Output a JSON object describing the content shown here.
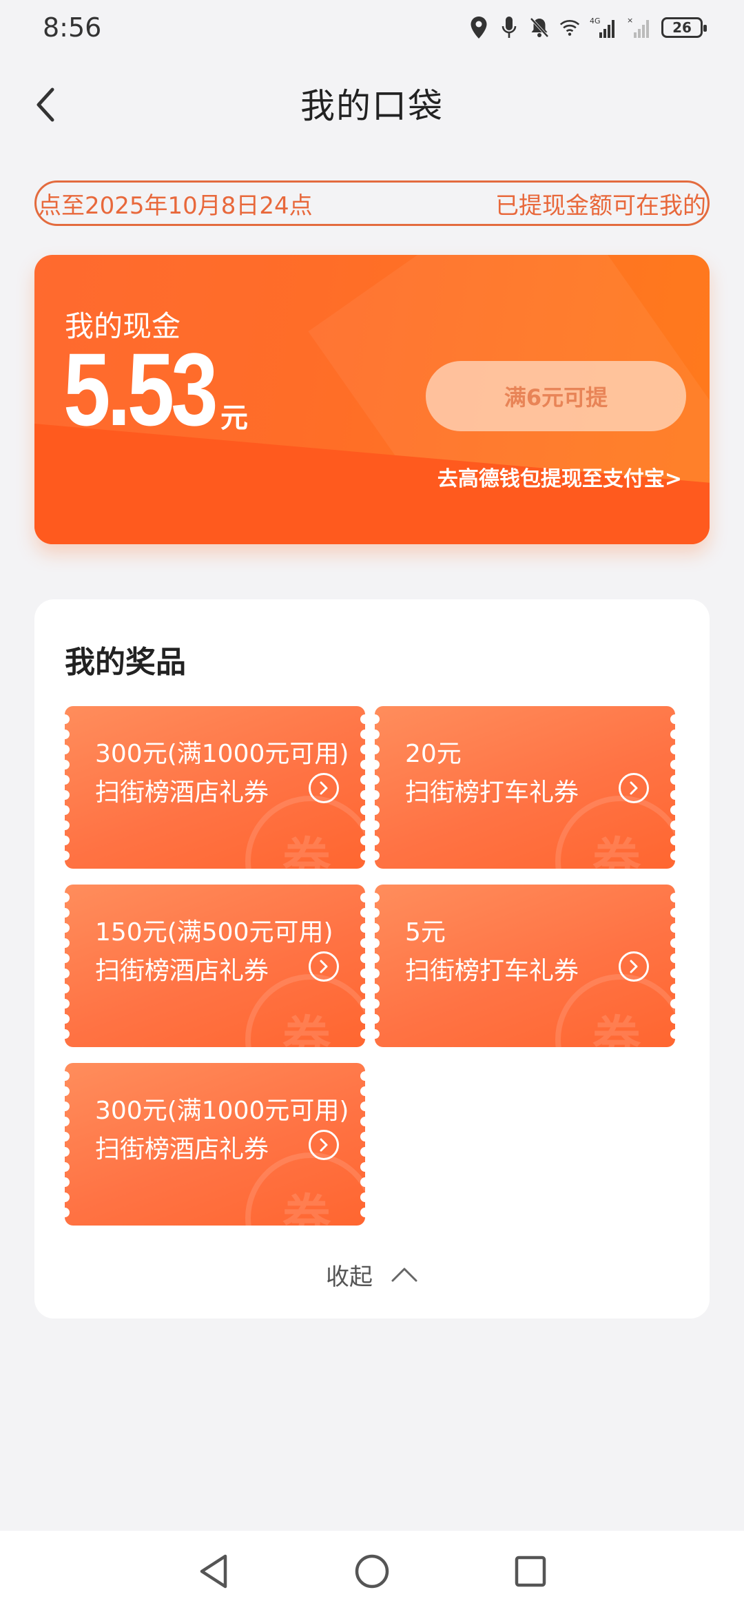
{
  "status_bar": {
    "time": "8:56",
    "network": "4G",
    "battery": "26"
  },
  "header": {
    "title": "我的口袋"
  },
  "notice": {
    "left_text": "点至2025年10月8日24点",
    "right_text": "已提现金额可在我的"
  },
  "cash": {
    "label": "我的现金",
    "amount": "5.53",
    "unit": "元",
    "withdraw_button": "满6元可提",
    "wallet_link": "去高德钱包提现至支付宝>"
  },
  "prizes": {
    "title": "我的奖品",
    "watermark": "券",
    "items": [
      {
        "amount": "300元(满1000元可用)",
        "name": "扫街榜酒店礼券"
      },
      {
        "amount": "20元",
        "name": "扫街榜打车礼券"
      },
      {
        "amount": "150元(满500元可用)",
        "name": "扫街榜酒店礼券"
      },
      {
        "amount": "5元",
        "name": "扫街榜打车礼券"
      },
      {
        "amount": "300元(满1000元可用)",
        "name": "扫街榜酒店礼券"
      }
    ],
    "collapse_label": "收起"
  },
  "colors": {
    "accent": "#ff6d28",
    "notice": "#e8683b",
    "coupon": "#ff7344",
    "background": "#f3f3f5"
  },
  "icons": {
    "back": "chevron-left-icon",
    "collapse": "chevron-up-icon",
    "coupon_arrow": "circle-chevron-right-icon",
    "nav_back": "triangle-back-icon",
    "nav_home": "circle-home-icon",
    "nav_recents": "square-recents-icon"
  }
}
